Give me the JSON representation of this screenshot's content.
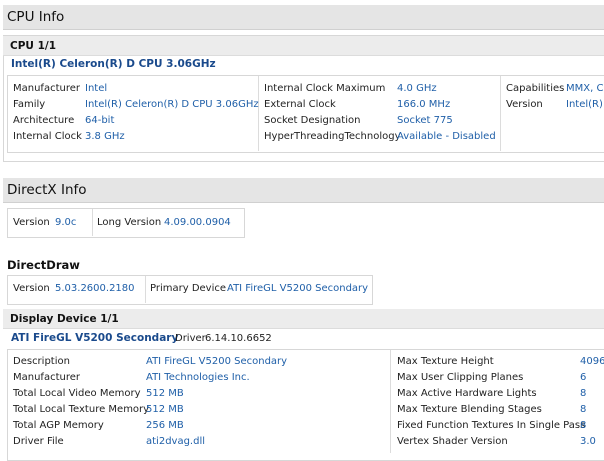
{
  "cpu_section": {
    "title": "CPU Info",
    "header": "CPU 1/1",
    "name": "Intel(R) Celeron(R) D CPU 3.06GHz",
    "col1": [
      {
        "label": "Manufacturer",
        "value": "Intel"
      },
      {
        "label": "Family",
        "value": "Intel(R) Celeron(R) D CPU 3.06GHz"
      },
      {
        "label": "Architecture",
        "value": "64-bit"
      },
      {
        "label": "Internal Clock",
        "value": "3.8 GHz"
      }
    ],
    "col2": [
      {
        "label": "Internal Clock Maximum",
        "value": "4.0 GHz"
      },
      {
        "label": "External Clock",
        "value": "166.0 MHz"
      },
      {
        "label": "Socket Designation",
        "value": "Socket 775"
      },
      {
        "label": "HyperThreadingTechnology",
        "value": "Available - Disabled"
      }
    ],
    "col3": [
      {
        "label": "Capabilities",
        "value": "MMX, CMOV"
      },
      {
        "label": "Version",
        "value": "Intel(R)"
      }
    ]
  },
  "directx_section": {
    "title": "DirectX Info",
    "version_label": "Version",
    "version_value": "9.0c",
    "long_version_label": "Long Version",
    "long_version_value": "4.09.00.0904"
  },
  "directdraw": {
    "title": "DirectDraw",
    "version_label": "Version",
    "version_value": "5.03.2600.2180",
    "primary_label": "Primary Device",
    "primary_value": "ATI FireGL V5200 Secondary"
  },
  "display_device": {
    "header": "Display Device 1/1",
    "name": "ATI FireGL V5200 Secondary",
    "driver_label": "Driver",
    "driver_value": "6.14.10.6652",
    "col1": [
      {
        "label": "Description",
        "value": "ATI FireGL V5200 Secondary"
      },
      {
        "label": "Manufacturer",
        "value": "ATI Technologies Inc."
      },
      {
        "label": "Total Local Video Memory",
        "value": "512 MB"
      },
      {
        "label": "Total Local Texture Memory",
        "value": "512 MB"
      },
      {
        "label": "Total AGP Memory",
        "value": "256 MB"
      },
      {
        "label": "Driver File",
        "value": "ati2dvag.dll"
      }
    ],
    "col2": [
      {
        "label": "Max Texture Height",
        "value": "4096"
      },
      {
        "label": "Max User Clipping Planes",
        "value": "6"
      },
      {
        "label": "Max Active Hardware Lights",
        "value": "8"
      },
      {
        "label": "Max Texture Blending Stages",
        "value": "8"
      },
      {
        "label": "Fixed Function Textures In Single Pass",
        "value": "8"
      },
      {
        "label": "Vertex Shader Version",
        "value": "3.0"
      }
    ]
  }
}
